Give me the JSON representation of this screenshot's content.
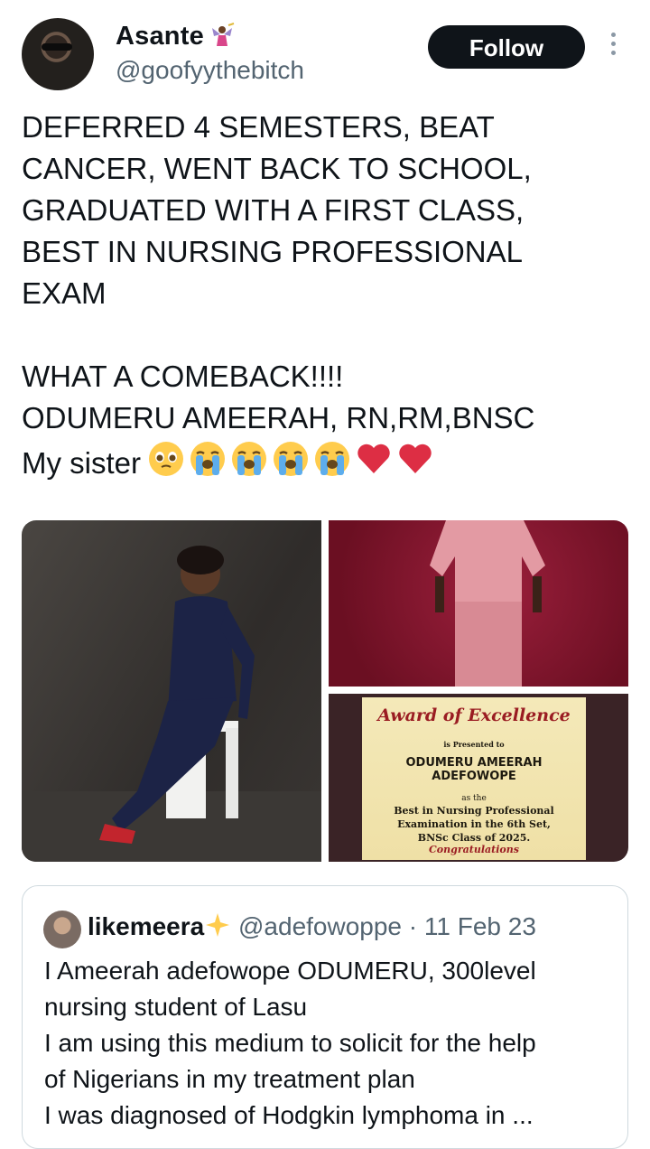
{
  "author": {
    "name": "Asante",
    "handle": "@goofyythebitch",
    "name_emoji": "fairy-icon"
  },
  "actions": {
    "follow_label": "Follow",
    "more_icon": "more-vertical-icon"
  },
  "tweet": {
    "lines": [
      "DEFERRED 4 SEMESTERS, BEAT",
      "CANCER, WENT BACK TO SCHOOL,",
      "GRADUATED WITH A FIRST CLASS,",
      "BEST IN NURSING PROFESSIONAL",
      "EXAM",
      "",
      "WHAT A COMEBACK!!!!",
      "ODUMERU AMEERAH, RN,RM,BNSC",
      "My sister"
    ],
    "emojis": [
      "pleading-face",
      "loudly-crying-face",
      "loudly-crying-face",
      "loudly-crying-face",
      "loudly-crying-face",
      "red-heart",
      "red-heart"
    ]
  },
  "certificate": {
    "title": "Award of Excellence",
    "presented": "is Presented to",
    "recipient": "ODUMERU AMEERAH ADEFOWOPE",
    "as_the": "as the",
    "line1": "Best in Nursing Professional",
    "line2": "Examination in the 6th Set,",
    "line3": "BNSc Class of 2025.",
    "closing": "Congratulations"
  },
  "quoted": {
    "name": "likemeera",
    "emoji": "sparkles",
    "handle": "@adefowoppe",
    "date": "· 11 Feb 23",
    "lines": [
      "I Ameerah adefowope ODUMERU, 300level",
      "nursing student of Lasu",
      "I am using this medium to solicit for the help",
      "of Nigerians in my treatment plan",
      "I was diagnosed of Hodgkin lymphoma in ..."
    ]
  },
  "colors": {
    "text": "#0f1419",
    "secondary": "#536471",
    "follow_bg": "#0f1419",
    "border": "#cfd9de"
  }
}
